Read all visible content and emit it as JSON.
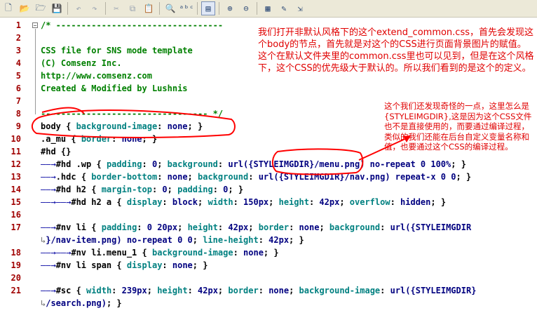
{
  "toolbar": {
    "buttons": [
      {
        "name": "new-file-icon",
        "glyph": "🗋",
        "active": false,
        "dim": false
      },
      {
        "name": "open-folder-icon",
        "glyph": "📂",
        "active": false,
        "dim": false
      },
      {
        "name": "open-file-icon",
        "glyph": "🗁",
        "active": false,
        "dim": false
      },
      {
        "name": "save-icon",
        "glyph": "💾",
        "active": false,
        "dim": false
      },
      {
        "name": "undo-icon",
        "glyph": "↶",
        "active": false,
        "dim": true
      },
      {
        "name": "redo-icon",
        "glyph": "↷",
        "active": false,
        "dim": true
      },
      {
        "name": "cut-icon",
        "glyph": "✂",
        "active": false,
        "dim": true
      },
      {
        "name": "copy-icon",
        "glyph": "⧉",
        "active": false,
        "dim": true
      },
      {
        "name": "paste-icon",
        "glyph": "📋",
        "active": false,
        "dim": false
      },
      {
        "name": "find-icon",
        "glyph": "🔍",
        "active": false,
        "dim": false
      },
      {
        "name": "spellcheck-icon",
        "glyph": "ᵃᵇᶜ",
        "active": false,
        "dim": false
      },
      {
        "name": "word-wrap-icon",
        "glyph": "▤",
        "active": true,
        "dim": false
      },
      {
        "name": "zoom-in-icon",
        "glyph": "⊕",
        "active": false,
        "dim": false
      },
      {
        "name": "zoom-out-icon",
        "glyph": "⊖",
        "active": false,
        "dim": false
      },
      {
        "name": "options-icon",
        "glyph": "▦",
        "active": false,
        "dim": false
      },
      {
        "name": "edit-pencil-icon",
        "glyph": "✎",
        "active": false,
        "dim": false
      },
      {
        "name": "run-icon",
        "glyph": "⇲",
        "active": false,
        "dim": false
      }
    ]
  },
  "lines": [
    {
      "n": "1",
      "segs": [
        [
          "cm",
          "/* ---------------------------------"
        ]
      ]
    },
    {
      "n": "2",
      "segs": []
    },
    {
      "n": "3",
      "segs": [
        [
          "cm",
          "CSS file for SNS mode template"
        ]
      ]
    },
    {
      "n": "4",
      "segs": [
        [
          "cm",
          "(C) Comsenz Inc."
        ]
      ]
    },
    {
      "n": "5",
      "segs": [
        [
          "cm",
          "http://www.comsenz.com"
        ]
      ]
    },
    {
      "n": "6",
      "segs": [
        [
          "cm",
          "Created & Modified by Lushnis"
        ]
      ]
    },
    {
      "n": "7",
      "segs": []
    },
    {
      "n": "8",
      "segs": [
        [
          "cm",
          "--------------------------------- */"
        ]
      ]
    },
    {
      "n": "9",
      "segs": [
        [
          "sel",
          "body "
        ],
        [
          "pn",
          "{ "
        ],
        [
          "prop",
          "background-image"
        ],
        [
          "pn",
          ": "
        ],
        [
          "val",
          "none"
        ],
        [
          "pn",
          "; }"
        ]
      ]
    },
    {
      "n": "10",
      "segs": [
        [
          "sel",
          ".a_mu "
        ],
        [
          "pn",
          "{ "
        ],
        [
          "prop",
          "border"
        ],
        [
          "pn",
          ": "
        ],
        [
          "val",
          "none"
        ],
        [
          "pn",
          "; }"
        ]
      ]
    },
    {
      "n": "11",
      "segs": [
        [
          "sel",
          "#hd "
        ],
        [
          "pn",
          "{}"
        ]
      ]
    },
    {
      "n": "12",
      "segs": [
        [
          "arrow",
          "——→"
        ],
        [
          "sel",
          "#hd .wp "
        ],
        [
          "pn",
          "{ "
        ],
        [
          "prop",
          "padding"
        ],
        [
          "pn",
          ": "
        ],
        [
          "val",
          "0"
        ],
        [
          "pn",
          "; "
        ],
        [
          "prop",
          "background"
        ],
        [
          "pn",
          ": "
        ],
        [
          "val",
          "url({STYLEIMGDIR}/menu.png) no-repeat 0 100%"
        ],
        [
          "pn",
          "; }"
        ]
      ]
    },
    {
      "n": "13",
      "segs": [
        [
          "arrow",
          "——→"
        ],
        [
          "sel",
          ".hdc "
        ],
        [
          "pn",
          "{ "
        ],
        [
          "prop",
          "border-bottom"
        ],
        [
          "pn",
          ": "
        ],
        [
          "val",
          "none"
        ],
        [
          "pn",
          "; "
        ],
        [
          "prop",
          "background"
        ],
        [
          "pn",
          ": "
        ],
        [
          "val",
          "url({STYLEIMGDIR}/nav.png) repeat-x 0 0"
        ],
        [
          "pn",
          "; }"
        ]
      ]
    },
    {
      "n": "14",
      "segs": [
        [
          "arrow",
          "——→"
        ],
        [
          "sel",
          "#hd h2 "
        ],
        [
          "pn",
          "{ "
        ],
        [
          "prop",
          "margin-top"
        ],
        [
          "pn",
          ": "
        ],
        [
          "val",
          "0"
        ],
        [
          "pn",
          "; "
        ],
        [
          "prop",
          "padding"
        ],
        [
          "pn",
          ": "
        ],
        [
          "val",
          "0"
        ],
        [
          "pn",
          "; }"
        ]
      ]
    },
    {
      "n": "15",
      "segs": [
        [
          "arrow",
          "——→——→"
        ],
        [
          "sel",
          "#hd h2 a "
        ],
        [
          "pn",
          "{ "
        ],
        [
          "prop",
          "display"
        ],
        [
          "pn",
          ": "
        ],
        [
          "val",
          "block"
        ],
        [
          "pn",
          "; "
        ],
        [
          "prop",
          "width"
        ],
        [
          "pn",
          ": "
        ],
        [
          "val",
          "150px"
        ],
        [
          "pn",
          "; "
        ],
        [
          "prop",
          "height"
        ],
        [
          "pn",
          ": "
        ],
        [
          "val",
          "42px"
        ],
        [
          "pn",
          "; "
        ],
        [
          "prop",
          "overflow"
        ],
        [
          "pn",
          ": "
        ],
        [
          "val",
          "hidden"
        ],
        [
          "pn",
          "; }"
        ]
      ]
    },
    {
      "n": "16",
      "segs": []
    },
    {
      "n": "17",
      "segs": [
        [
          "arrow",
          "——→"
        ],
        [
          "sel",
          "#nv li "
        ],
        [
          "pn",
          "{ "
        ],
        [
          "prop",
          "padding"
        ],
        [
          "pn",
          ": "
        ],
        [
          "val",
          "0 20px"
        ],
        [
          "pn",
          "; "
        ],
        [
          "prop",
          "height"
        ],
        [
          "pn",
          ": "
        ],
        [
          "val",
          "42px"
        ],
        [
          "pn",
          "; "
        ],
        [
          "prop",
          "border"
        ],
        [
          "pn",
          ": "
        ],
        [
          "val",
          "none"
        ],
        [
          "pn",
          "; "
        ],
        [
          "prop",
          "background"
        ],
        [
          "pn",
          ": "
        ],
        [
          "val",
          "url({STYLEIMGDIR"
        ]
      ]
    },
    {
      "n": "",
      "segs": [
        [
          "wrap",
          "↳"
        ],
        [
          "val",
          "}/nav-item.png) no-repeat 0 0"
        ],
        [
          "pn",
          "; "
        ],
        [
          "prop",
          "line-height"
        ],
        [
          "pn",
          ": "
        ],
        [
          "val",
          "42px"
        ],
        [
          "pn",
          "; }"
        ]
      ]
    },
    {
      "n": "18",
      "segs": [
        [
          "arrow",
          "——→——→"
        ],
        [
          "sel",
          "#nv li.menu_1 "
        ],
        [
          "pn",
          "{ "
        ],
        [
          "prop",
          "background-image"
        ],
        [
          "pn",
          ": "
        ],
        [
          "val",
          "none"
        ],
        [
          "pn",
          "; }"
        ]
      ]
    },
    {
      "n": "19",
      "segs": [
        [
          "arrow",
          "——→"
        ],
        [
          "sel",
          "#nv li span "
        ],
        [
          "pn",
          "{ "
        ],
        [
          "prop",
          "display"
        ],
        [
          "pn",
          ": "
        ],
        [
          "val",
          "none"
        ],
        [
          "pn",
          "; }"
        ]
      ]
    },
    {
      "n": "20",
      "segs": []
    },
    {
      "n": "21",
      "segs": [
        [
          "arrow",
          "——→"
        ],
        [
          "sel",
          "#sc "
        ],
        [
          "pn",
          "{ "
        ],
        [
          "prop",
          "width"
        ],
        [
          "pn",
          ": "
        ],
        [
          "val",
          "239px"
        ],
        [
          "pn",
          "; "
        ],
        [
          "prop",
          "height"
        ],
        [
          "pn",
          ": "
        ],
        [
          "val",
          "42px"
        ],
        [
          "pn",
          "; "
        ],
        [
          "prop",
          "border"
        ],
        [
          "pn",
          ": "
        ],
        [
          "val",
          "none"
        ],
        [
          "pn",
          "; "
        ],
        [
          "prop",
          "background-image"
        ],
        [
          "pn",
          ": "
        ],
        [
          "val",
          "url({STYLEIMGDIR}"
        ]
      ]
    },
    {
      "n": "",
      "segs": [
        [
          "wrap",
          "↳"
        ],
        [
          "val",
          "/search.png)"
        ],
        [
          "pn",
          "; }"
        ]
      ]
    }
  ],
  "annotations": {
    "note1": "我们打开非默认风格下的这个extend_common.css，首先会发现这个body的节点，首先就是对这个的CSS进行页面背景图片的赋值。这个在默认文件夹里的common.css里也可以见到，但是在这个风格下，这个CSS的优先级大于默认的。所以我们看到的是这个的定义。",
    "note2": "这个我们还发现奇怪的一点，这里怎么是{STYLEIMGDIR},这是因为这个CSS文件也不是直接使用的，而要通过编译过程，类似的我们还能在后台自定义变量名称和值，也要通过这个CSS的编译过程。"
  },
  "colors": {
    "annotation": "#e00000",
    "line_number": "#a00000",
    "comment": "#008000",
    "property": "#008080",
    "value": "#000080"
  }
}
